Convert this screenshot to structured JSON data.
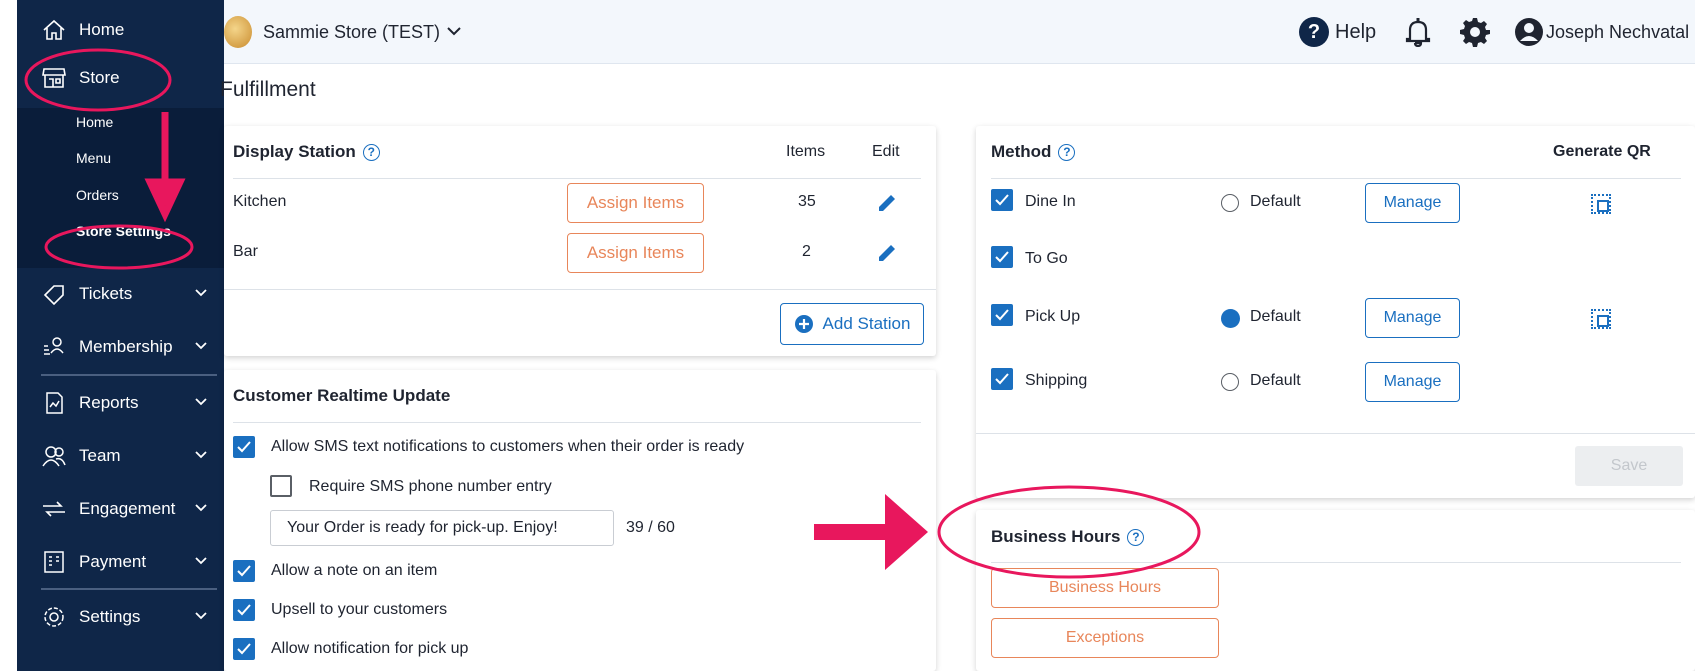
{
  "sidebar": {
    "home": "Home",
    "store": "Store",
    "sub": [
      "Home",
      "Menu",
      "Orders",
      "Store Settings"
    ],
    "tickets": "Tickets",
    "membership": "Membership",
    "reports": "Reports",
    "team": "Team",
    "engagement": "Engagement",
    "payment": "Payment",
    "settings": "Settings"
  },
  "header": {
    "store_name": "Sammie Store (TEST)",
    "help": "Help",
    "user_name": "Joseph Nechvatal"
  },
  "page_title": "Fulfillment",
  "display_station": {
    "title": "Display Station",
    "col_items": "Items",
    "col_edit": "Edit",
    "rows": [
      {
        "name": "Kitchen",
        "button": "Assign Items",
        "items": "35"
      },
      {
        "name": "Bar",
        "button": "Assign Items",
        "items": "2"
      }
    ],
    "add_station": "Add Station"
  },
  "customer_update": {
    "title": "Customer Realtime Update",
    "sms_label": "Allow SMS text notifications to customers when their order is ready",
    "require_sms": "Require SMS phone number entry",
    "message_value": "Your Order is ready for pick-up. Enjoy!",
    "char_count": "39 / 60",
    "note_label": "Allow a note on an item",
    "upsell_label": "Upsell to your customers",
    "pickup_notify_label": "Allow notification for pick up"
  },
  "method": {
    "title": "Method",
    "col_qr": "Generate QR",
    "rows": [
      {
        "name": "Dine In",
        "default": "Default",
        "default_selected": false,
        "manage": "Manage"
      },
      {
        "name": "To Go"
      },
      {
        "name": "Pick Up",
        "default": "Default",
        "default_selected": true,
        "manage": "Manage"
      },
      {
        "name": "Shipping",
        "default": "Default",
        "default_selected": false,
        "manage": "Manage"
      }
    ],
    "save": "Save"
  },
  "business_hours": {
    "title": "Business Hours",
    "hours_button": "Business Hours",
    "exceptions_button": "Exceptions"
  },
  "colors": {
    "sidebar": "#0f2648",
    "accent_blue": "#1a6fc0",
    "accent_orange": "#e8865a",
    "annotation": "#e8175d"
  }
}
